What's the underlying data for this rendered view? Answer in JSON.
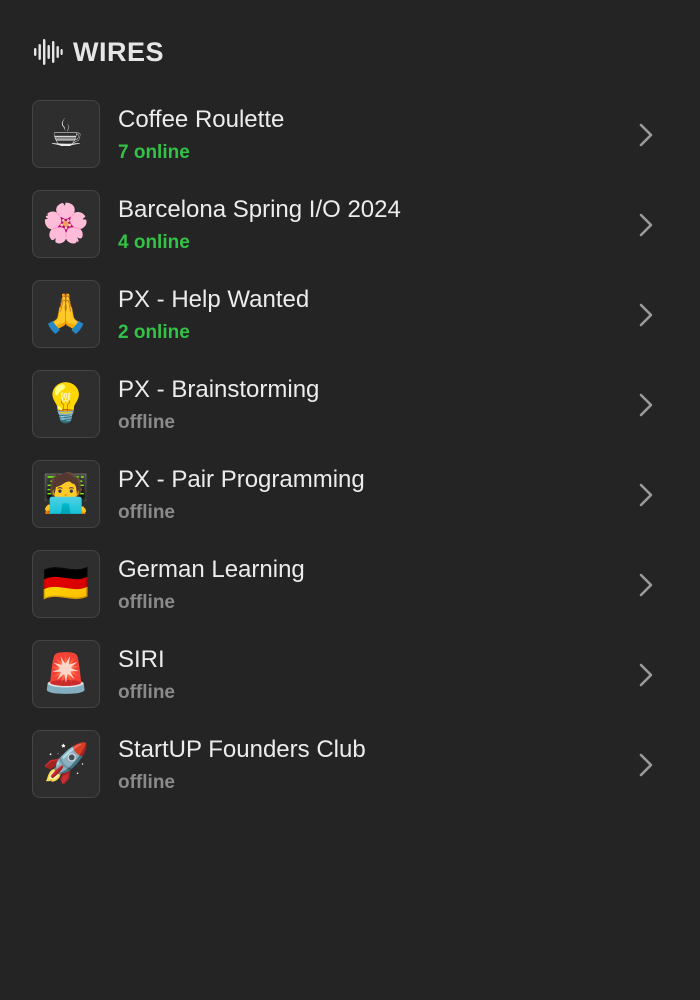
{
  "header": {
    "icon": "waveform-icon",
    "title": "WIRES"
  },
  "colors": {
    "background": "#242424",
    "online": "#33c246",
    "offline": "#8a8a8a"
  },
  "wires": [
    {
      "emoji": "☕",
      "icon": "coffee-icon",
      "name": "Coffee Roulette",
      "status": "7 online",
      "online": true
    },
    {
      "emoji": "🌸",
      "icon": "cherry-blossom-icon",
      "name": "Barcelona Spring I/O 2024",
      "status": "4 online",
      "online": true
    },
    {
      "emoji": "🙏",
      "icon": "folded-hands-icon",
      "name": "PX - Help Wanted",
      "status": "2 online",
      "online": true
    },
    {
      "emoji": "💡",
      "icon": "light-bulb-icon",
      "name": "PX - Brainstorming",
      "status": "offline",
      "online": false
    },
    {
      "emoji": "🧑‍💻",
      "icon": "technologist-icon",
      "name": "PX - Pair Programming",
      "status": "offline",
      "online": false
    },
    {
      "emoji": "🇩🇪",
      "icon": "germany-flag-icon",
      "name": "German Learning",
      "status": "offline",
      "online": false
    },
    {
      "emoji": "🚨",
      "icon": "siren-icon",
      "name": "SIRI",
      "status": "offline",
      "online": false
    },
    {
      "emoji": "🚀",
      "icon": "rocket-icon",
      "name": "StartUP Founders Club",
      "status": "offline",
      "online": false
    }
  ]
}
